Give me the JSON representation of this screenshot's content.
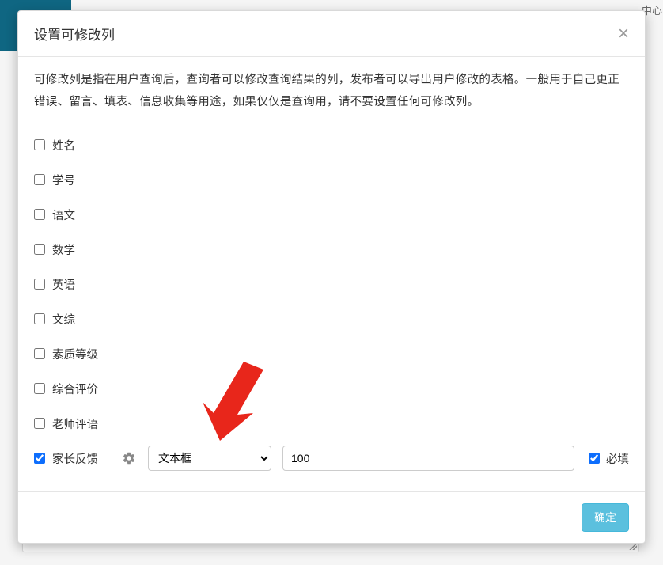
{
  "bg": {
    "corner_text": "中心"
  },
  "modal": {
    "title": "设置可修改列",
    "description": "可修改列是指在用户查询后，查询者可以修改查询结果的列，发布者可以导出用户修改的表格。一般用于自己更正错误、留言、填表、信息收集等用途，如果仅仅是查询用，请不要设置任何可修改列。",
    "columns": [
      {
        "label": "姓名",
        "checked": false
      },
      {
        "label": "学号",
        "checked": false
      },
      {
        "label": "语文",
        "checked": false
      },
      {
        "label": "数学",
        "checked": false
      },
      {
        "label": "英语",
        "checked": false
      },
      {
        "label": "文综",
        "checked": false
      },
      {
        "label": "素质等级",
        "checked": false
      },
      {
        "label": "综合评价",
        "checked": false
      },
      {
        "label": "老师评语",
        "checked": false
      },
      {
        "label": "家长反馈",
        "checked": true
      }
    ],
    "controls": {
      "select_value": "文本框",
      "input_value": "100",
      "required_label": "必填",
      "required_checked": true
    },
    "confirm_button": "确定"
  }
}
